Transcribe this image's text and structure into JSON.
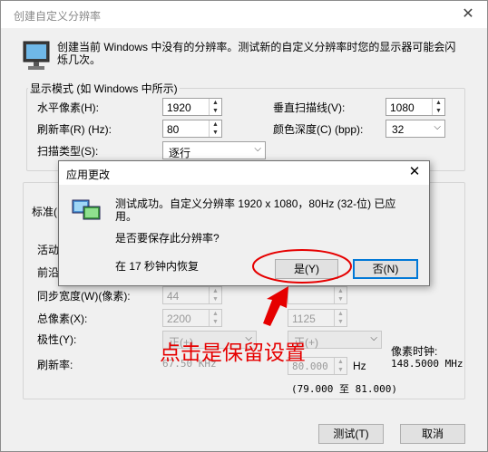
{
  "main": {
    "title": "创建自定义分辨率",
    "header": "创建当前 Windows 中没有的分辨率。测试新的自定义分辨率时您的显示器可能会闪烁几次。",
    "display_mode": {
      "legend": "显示模式 (如 Windows 中所示)",
      "horizontal_pixels_label": "水平像素(H):",
      "horizontal_pixels_value": "1920",
      "vertical_lines_label": "垂直扫描线(V):",
      "vertical_lines_value": "1080",
      "refresh_rate_label": "刷新率(R) (Hz):",
      "refresh_rate_value": "80",
      "color_depth_label": "颜色深度(C) (bpp):",
      "color_depth_value": "32",
      "scan_type_label": "扫描类型(S):",
      "scan_type_value": "逐行"
    },
    "timing": {
      "standard_label": "标准(",
      "active_label": "活动",
      "front_porch_label": "前沿",
      "sync_width_label": "同步宽度(W)(像素):",
      "sync_width_h": "44",
      "total_pixels_label": "总像素(X):",
      "total_pixels_h": "2200",
      "total_pixels_v": "1125",
      "polarity_label": "极性(Y):",
      "polarity_h": "正(+)",
      "polarity_v": "正(+)",
      "pixel_clock_label": "像素时钟:",
      "pixel_clock_value": "148.5000 MHz",
      "refresh_label": "刷新率:",
      "refresh_h": "67.50 KHz",
      "refresh_v": "80.000",
      "refresh_unit": "Hz",
      "range": "(79.000 至 81.000)"
    },
    "buttons": {
      "test": "测试(T)",
      "cancel": "取消"
    }
  },
  "dialog": {
    "title": "应用更改",
    "message": "测试成功。自定义分辨率 1920 x 1080，80Hz (32-位) 已应用。",
    "question": "是否要保存此分辨率?",
    "countdown": "在 17 秒钟内恢复",
    "yes_button": "是(Y)",
    "no_button": "否(N)"
  },
  "annotation": {
    "text": "点击是保留设置",
    "color": "#e60000"
  }
}
